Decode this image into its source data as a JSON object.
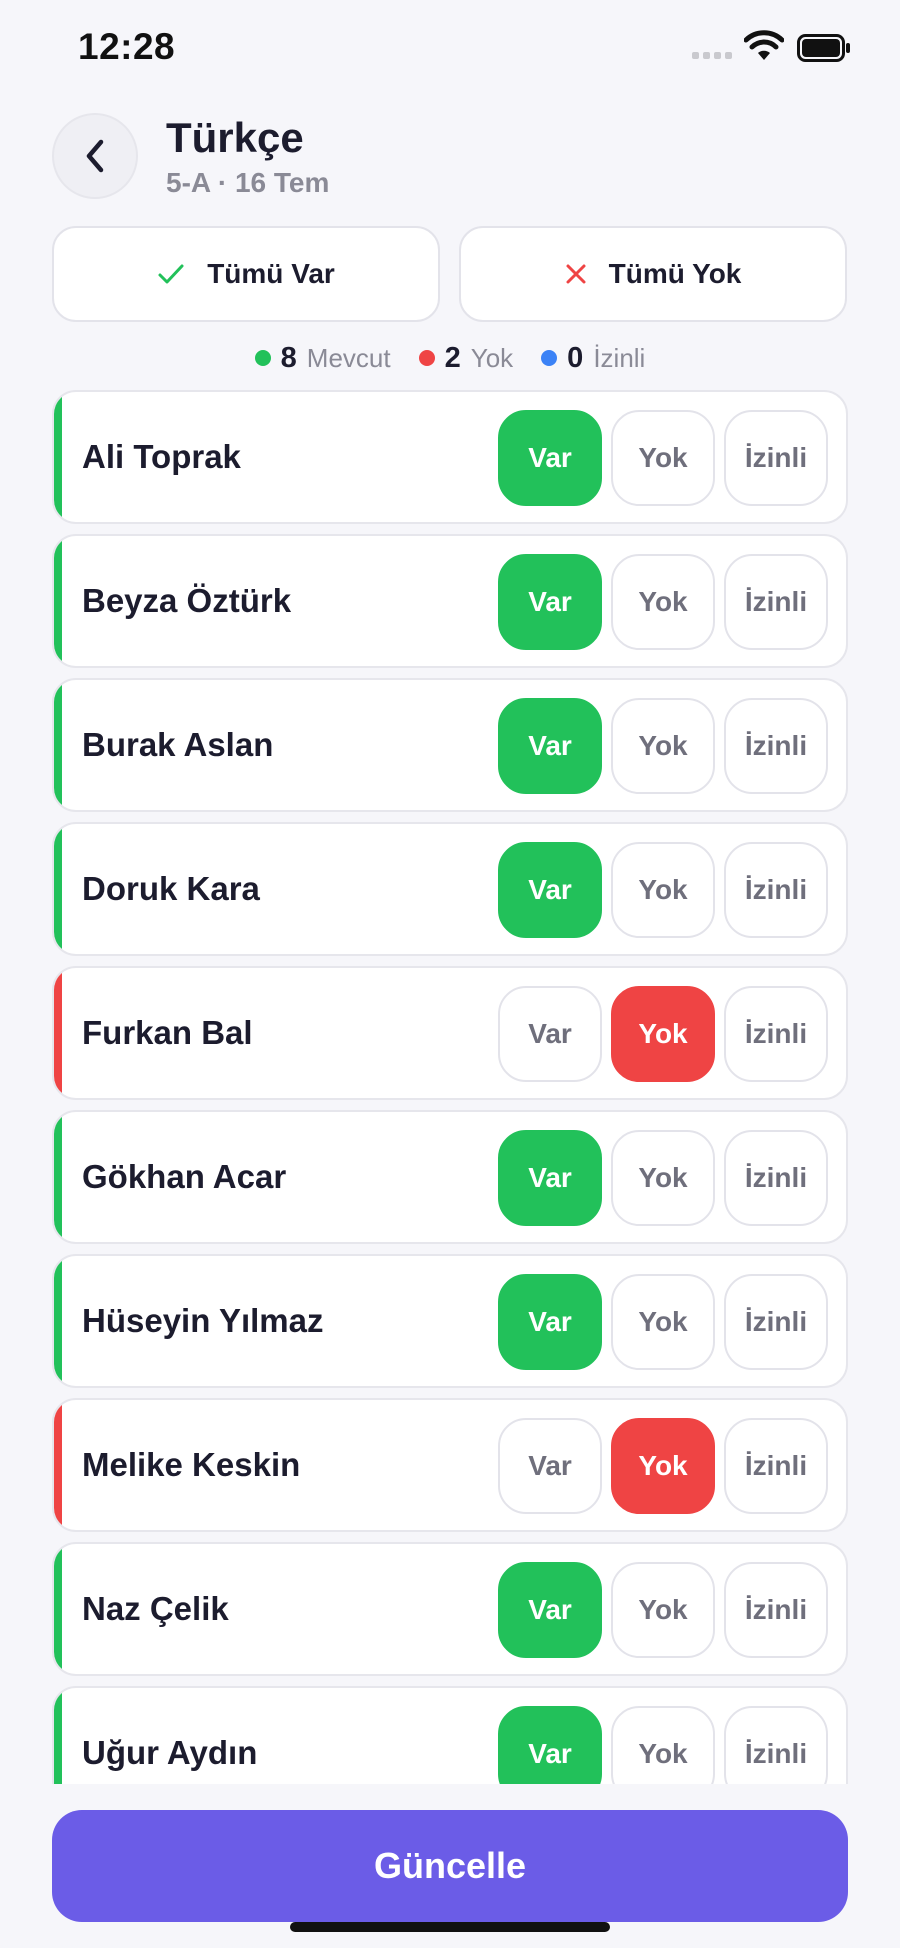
{
  "status_bar": {
    "time": "12:28"
  },
  "header": {
    "title": "Türkçe",
    "subtitle": "5-A · 16 Tem"
  },
  "bulk_actions": {
    "all_present": "Tümü Var",
    "all_absent": "Tümü Yok"
  },
  "summary": {
    "present_count": "8",
    "present_label": "Mevcut",
    "absent_count": "2",
    "absent_label": "Yok",
    "excused_count": "0",
    "excused_label": "İzinli"
  },
  "options": {
    "present": "Var",
    "absent": "Yok",
    "excused": "İzinli"
  },
  "students": [
    {
      "name": "Ali Toprak",
      "status": "present"
    },
    {
      "name": "Beyza Öztürk",
      "status": "present"
    },
    {
      "name": "Burak Aslan",
      "status": "present"
    },
    {
      "name": "Doruk Kara",
      "status": "present"
    },
    {
      "name": "Furkan Bal",
      "status": "absent"
    },
    {
      "name": "Gökhan Acar",
      "status": "present"
    },
    {
      "name": "Hüseyin Yılmaz",
      "status": "present"
    },
    {
      "name": "Melike Keskin",
      "status": "absent"
    },
    {
      "name": "Naz Çelik",
      "status": "present"
    },
    {
      "name": "Uğur Aydın",
      "status": "present"
    }
  ],
  "update_button": "Güncelle",
  "colors": {
    "present": "#22c15a",
    "absent": "#ef4444",
    "excused": "#3b82f6",
    "accent": "#6b5ce7"
  }
}
